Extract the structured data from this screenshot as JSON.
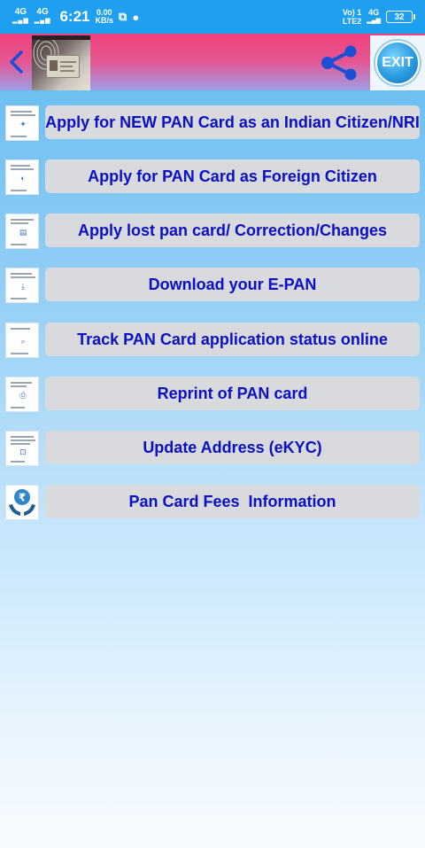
{
  "status_bar": {
    "sim1": "4G",
    "sim2": "4G",
    "time": "6:21",
    "speed_value": "0.00",
    "speed_unit": "KB/s",
    "volte_top": "Vo) 1",
    "volte_bottom": "LTE2",
    "network": "4G",
    "battery": "32"
  },
  "app_bar": {
    "exit_label": "EXIT",
    "icons": [
      "back-arrow-icon",
      "share-icon",
      "exit-icon"
    ]
  },
  "menu": {
    "items": [
      {
        "label": "Apply for NEW PAN Card as an Indian Citizen/NRI",
        "icon": "form-thumbnail-icon"
      },
      {
        "label": "Apply for PAN Card as Foreign Citizen",
        "icon": "form-thumbnail-icon"
      },
      {
        "label": "Apply lost pan card/ Correction/Changes",
        "icon": "form-thumbnail-icon"
      },
      {
        "label": "Download your E-PAN",
        "icon": "download-thumbnail-icon"
      },
      {
        "label": "Track PAN Card application status online",
        "icon": "search-thumbnail-icon"
      },
      {
        "label": "Reprint of PAN card",
        "icon": "form-thumbnail-icon"
      },
      {
        "label": "Update Address (eKYC)",
        "icon": "form-thumbnail-icon"
      },
      {
        "label": "Pan Card Fees  Information",
        "icon": "rupee-hands-icon"
      }
    ]
  },
  "colors": {
    "status_bar": "#1e9ff0",
    "app_bar_top": "#f0407c",
    "app_bar_bottom": "#9e9ee8",
    "button_bg": "#d9dadd",
    "button_text": "#0b10c4",
    "accent": "#1276bd"
  }
}
